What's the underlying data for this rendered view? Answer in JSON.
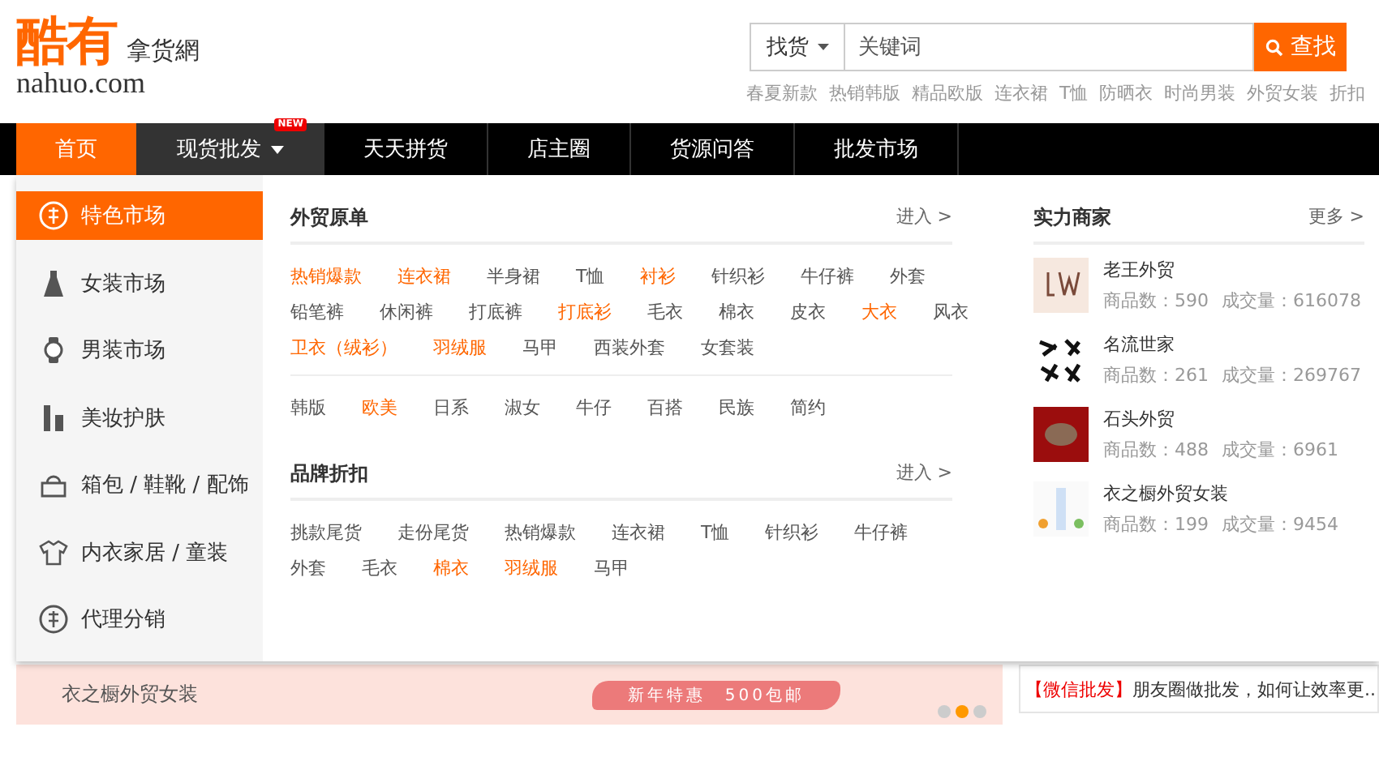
{
  "logo": {
    "brand": "酷有",
    "tagline": "拿货網",
    "domain": "nahuo.com"
  },
  "search": {
    "scope": "找货",
    "placeholder": "关键词",
    "button": "查找",
    "hot_words": [
      "春夏新款",
      "热销韩版",
      "精品欧版",
      "连衣裙",
      "T恤",
      "防晒衣",
      "时尚男装",
      "外贸女装",
      "折扣"
    ]
  },
  "nav": [
    {
      "label": "首页",
      "selected": true,
      "expanded": false
    },
    {
      "label": "现货批发",
      "selected": false,
      "expanded": true,
      "badge": "NEW"
    },
    {
      "label": "天天拼货",
      "selected": false,
      "expanded": false
    },
    {
      "label": "店主圈",
      "selected": false,
      "expanded": false
    },
    {
      "label": "货源问答",
      "selected": false,
      "expanded": false
    },
    {
      "label": "批发市场",
      "selected": false,
      "expanded": false
    }
  ],
  "sidebar": [
    {
      "label": "特色市场",
      "kind": "te",
      "selected": true
    },
    {
      "label": "女装市场",
      "kind": "dress",
      "selected": false
    },
    {
      "label": "男装市场",
      "kind": "watch",
      "selected": false
    },
    {
      "label": "美妆护肤",
      "kind": "cosmetics",
      "selected": false
    },
    {
      "label": "箱包 / 鞋靴 / 配饰",
      "kind": "bag",
      "selected": false
    },
    {
      "label": "内衣家居 / 童装",
      "kind": "shirt",
      "selected": false
    },
    {
      "label": "代理分销",
      "kind": "dai",
      "selected": false
    }
  ],
  "sections": [
    {
      "title": "外贸原单",
      "link": "进入 >",
      "groups": [
        [
          [
            {
              "text": "热销爆款",
              "hot": true
            },
            {
              "text": "连衣裙",
              "hot": true
            },
            {
              "text": "半身裙",
              "hot": false
            },
            {
              "text": "T恤",
              "hot": false
            },
            {
              "text": "衬衫",
              "hot": true
            },
            {
              "text": "针织衫",
              "hot": false
            },
            {
              "text": "牛仔裤",
              "hot": false
            },
            {
              "text": "外套",
              "hot": false
            }
          ],
          [
            {
              "text": "铅笔裤",
              "hot": false
            },
            {
              "text": "休闲裤",
              "hot": false
            },
            {
              "text": "打底裤",
              "hot": false
            },
            {
              "text": "打底衫",
              "hot": true
            },
            {
              "text": "毛衣",
              "hot": false
            },
            {
              "text": "棉衣",
              "hot": false
            },
            {
              "text": "皮衣",
              "hot": false
            },
            {
              "text": "大衣",
              "hot": true
            },
            {
              "text": "风衣",
              "hot": false
            }
          ],
          [
            {
              "text": "卫衣（绒衫）",
              "hot": true
            },
            {
              "text": "羽绒服",
              "hot": true
            },
            {
              "text": "马甲",
              "hot": false
            },
            {
              "text": "西装外套",
              "hot": false
            },
            {
              "text": "女套装",
              "hot": false
            }
          ]
        ],
        [
          [
            {
              "text": "韩版",
              "hot": false
            },
            {
              "text": "欧美",
              "hot": true
            },
            {
              "text": "日系",
              "hot": false
            },
            {
              "text": "淑女",
              "hot": false
            },
            {
              "text": "牛仔",
              "hot": false
            },
            {
              "text": "百搭",
              "hot": false
            },
            {
              "text": "民族",
              "hot": false
            },
            {
              "text": "简约",
              "hot": false
            }
          ]
        ]
      ]
    },
    {
      "title": "品牌折扣",
      "link": "进入 >",
      "groups": [
        [
          [
            {
              "text": "挑款尾货",
              "hot": false
            },
            {
              "text": "走份尾货",
              "hot": false
            },
            {
              "text": "热销爆款",
              "hot": false
            },
            {
              "text": "连衣裙",
              "hot": false
            },
            {
              "text": "T恤",
              "hot": false
            },
            {
              "text": "针织衫",
              "hot": false
            },
            {
              "text": "牛仔裤",
              "hot": false
            }
          ],
          [
            {
              "text": "外套",
              "hot": false
            },
            {
              "text": "毛衣",
              "hot": false
            },
            {
              "text": "棉衣",
              "hot": true
            },
            {
              "text": "羽绒服",
              "hot": true
            },
            {
              "text": "马甲",
              "hot": false
            }
          ]
        ]
      ]
    }
  ],
  "merchants": {
    "title": "实力商家",
    "link": "更多 >",
    "items": [
      {
        "name": "老王外贸",
        "goods": "商品数：590",
        "sales": "成交量：616078",
        "kind": "lw"
      },
      {
        "name": "名流世家",
        "goods": "商品数：261",
        "sales": "成交量：269767",
        "kind": "calligraphy"
      },
      {
        "name": "石头外贸",
        "goods": "商品数：488",
        "sales": "成交量：6961",
        "kind": "red"
      },
      {
        "name": "衣之橱外贸女装",
        "goods": "商品数：199",
        "sales": "成交量：9454",
        "kind": "light"
      }
    ]
  },
  "banner": {
    "title": "衣之橱外贸女装",
    "promo": "新年特惠　500包邮",
    "dots": [
      {
        "selected": false
      },
      {
        "selected": true
      },
      {
        "selected": false
      }
    ]
  },
  "news": {
    "tag": "【微信批发】",
    "text": "朋友圈做批发，如何让效率更..."
  }
}
